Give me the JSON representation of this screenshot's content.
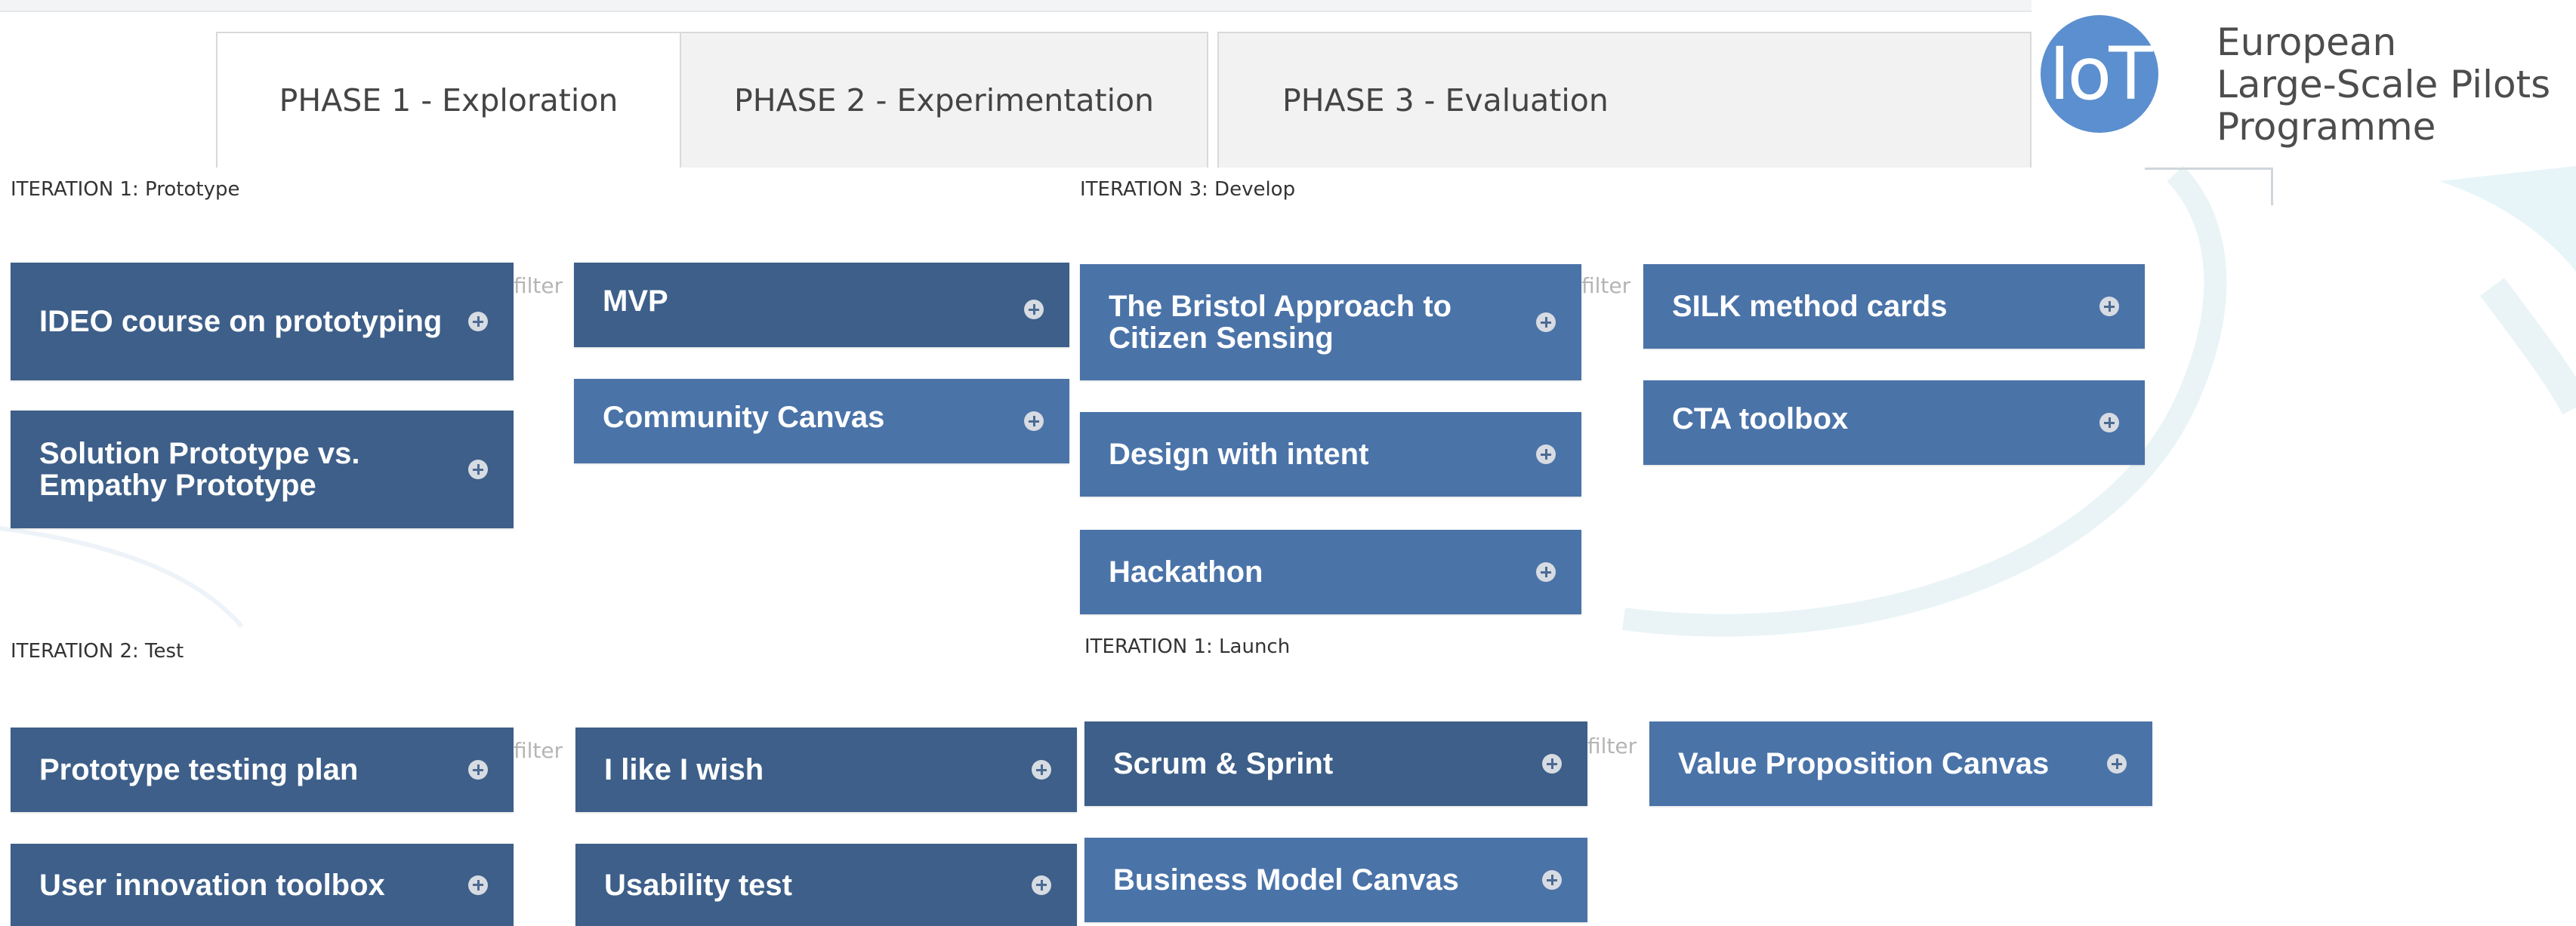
{
  "tabs": [
    {
      "label": "PHASE 1 - Exploration",
      "active": true
    },
    {
      "label": "PHASE 2 - Experimentation",
      "active": false
    },
    {
      "label": "PHASE 3 - Evaluation",
      "active": false
    }
  ],
  "logo": {
    "mark": "IoT",
    "line1": "European",
    "line2": "Large-Scale Pilots",
    "line3": "Programme"
  },
  "filter_label": "filter",
  "sections": {
    "iter1_prototype": {
      "label": "ITERATION 1: Prototype",
      "left": [
        "IDEO course on prototyping",
        "Solution Prototype vs. Empathy Prototype"
      ],
      "right": [
        "MVP",
        "Community Canvas"
      ]
    },
    "iter2_test": {
      "label": "ITERATION 2: Test",
      "left": [
        "Prototype testing plan",
        "User innovation toolbox"
      ],
      "right": [
        "I like I wish",
        "Usability test"
      ]
    },
    "iter3_develop": {
      "label": "ITERATION 3: Develop",
      "left": [
        "The Bristol Approach to Citizen Sensing",
        "Design with intent",
        "Hackathon"
      ],
      "right": [
        "SILK method cards",
        "CTA toolbox"
      ]
    },
    "iter1_launch": {
      "label": "ITERATION 1: Launch",
      "left": [
        "Scrum & Sprint",
        "Business Model Canvas"
      ],
      "right": [
        "Value Proposition Canvas"
      ]
    }
  },
  "colors": {
    "card_dark": "#3d5f89",
    "card_light": "#4a73a8",
    "logo_blue": "#5b8fcf",
    "plus_icon": "#d7dbe2"
  }
}
